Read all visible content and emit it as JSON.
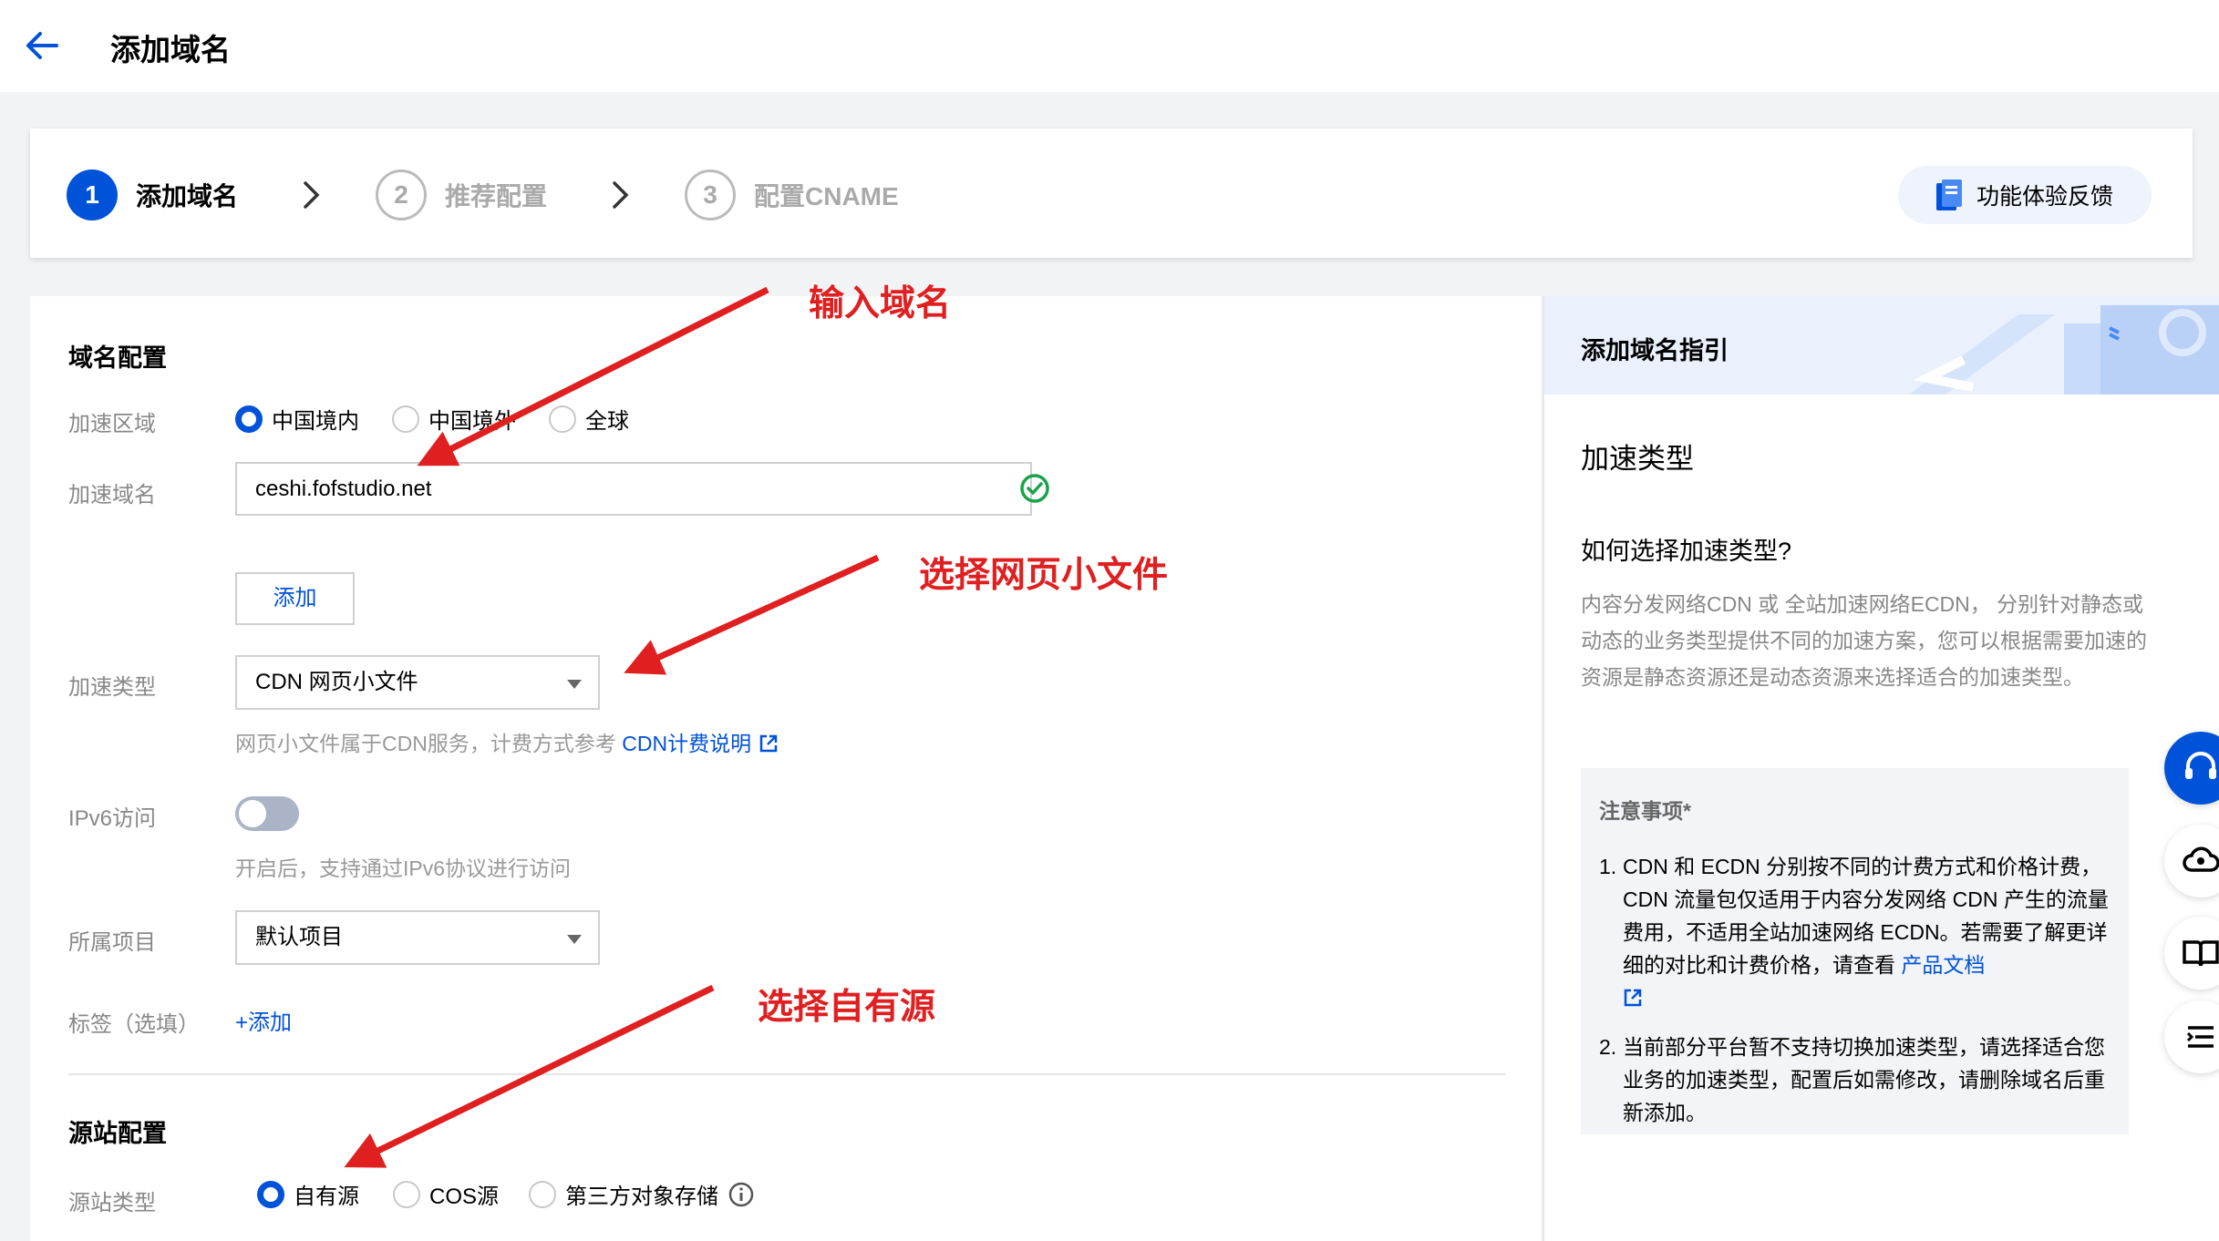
{
  "header": {
    "title": "添加域名"
  },
  "steps": [
    {
      "num": "1",
      "label": "添加域名"
    },
    {
      "num": "2",
      "label": "推荐配置"
    },
    {
      "num": "3",
      "label": "配置CNAME"
    }
  ],
  "feedback": {
    "label": "功能体验反馈"
  },
  "domain_config": {
    "section_title": "域名配置",
    "region_label": "加速区域",
    "region_options": [
      "中国境内",
      "中国境外",
      "全球"
    ],
    "domain_label": "加速域名",
    "domain_value": "ceshi.fofstudio.net",
    "add_label": "添加",
    "type_label": "加速类型",
    "type_value": "CDN 网页小文件",
    "type_hint": "网页小文件属于CDN服务，计费方式参考",
    "type_hint_link": "CDN计费说明",
    "ipv6_label": "IPv6访问",
    "ipv6_hint": "开启后，支持通过IPv6协议进行访问",
    "project_label": "所属项目",
    "project_value": "默认项目",
    "tag_label": "标签（选填）",
    "tag_add": "添加"
  },
  "origin_config": {
    "section_title": "源站配置",
    "type_label": "源站类型",
    "options": [
      "自有源",
      "COS源",
      "第三方对象存储"
    ]
  },
  "guide": {
    "title": "添加域名指引",
    "h2": "加速类型",
    "h3": "如何选择加速类型?",
    "paragraph": "内容分发网络CDN 或 全站加速网络ECDN， 分别针对静态或动态的业务类型提供不同的加速方案，您可以根据需要加速的资源是静态资源还是动态资源来选择适合的加速类型。",
    "notice_title": "注意事项*",
    "notice_items": [
      {
        "num": "1.",
        "text": "CDN 和 ECDN 分别按不同的计费方式和价格计费，CDN 流量包仅适用于内容分发网络 CDN 产生的流量费用，不适用全站加速网络 ECDN。若需要了解更详细的对比和计费价格，请查看 ",
        "link": "产品文档"
      },
      {
        "num": "2.",
        "text": "当前部分平台暂不支持切换加速类型，请选择适合您业务的加速类型，配置后如需修改，请删除域名后重新添加。"
      }
    ]
  },
  "annotations": {
    "a1": "输入域名",
    "a2": "选择网页小文件",
    "a3": "选择自有源"
  },
  "colors": {
    "accent": "#0052d9",
    "annotation": "#e02020",
    "success": "#1aa34a"
  },
  "icons": [
    "back-arrow-icon",
    "chevron-right-icon",
    "feedback-doc-icon",
    "check-circle-icon",
    "external-link-icon",
    "info-icon",
    "headset-icon",
    "cloud-user-icon",
    "book-icon",
    "list-icon"
  ]
}
